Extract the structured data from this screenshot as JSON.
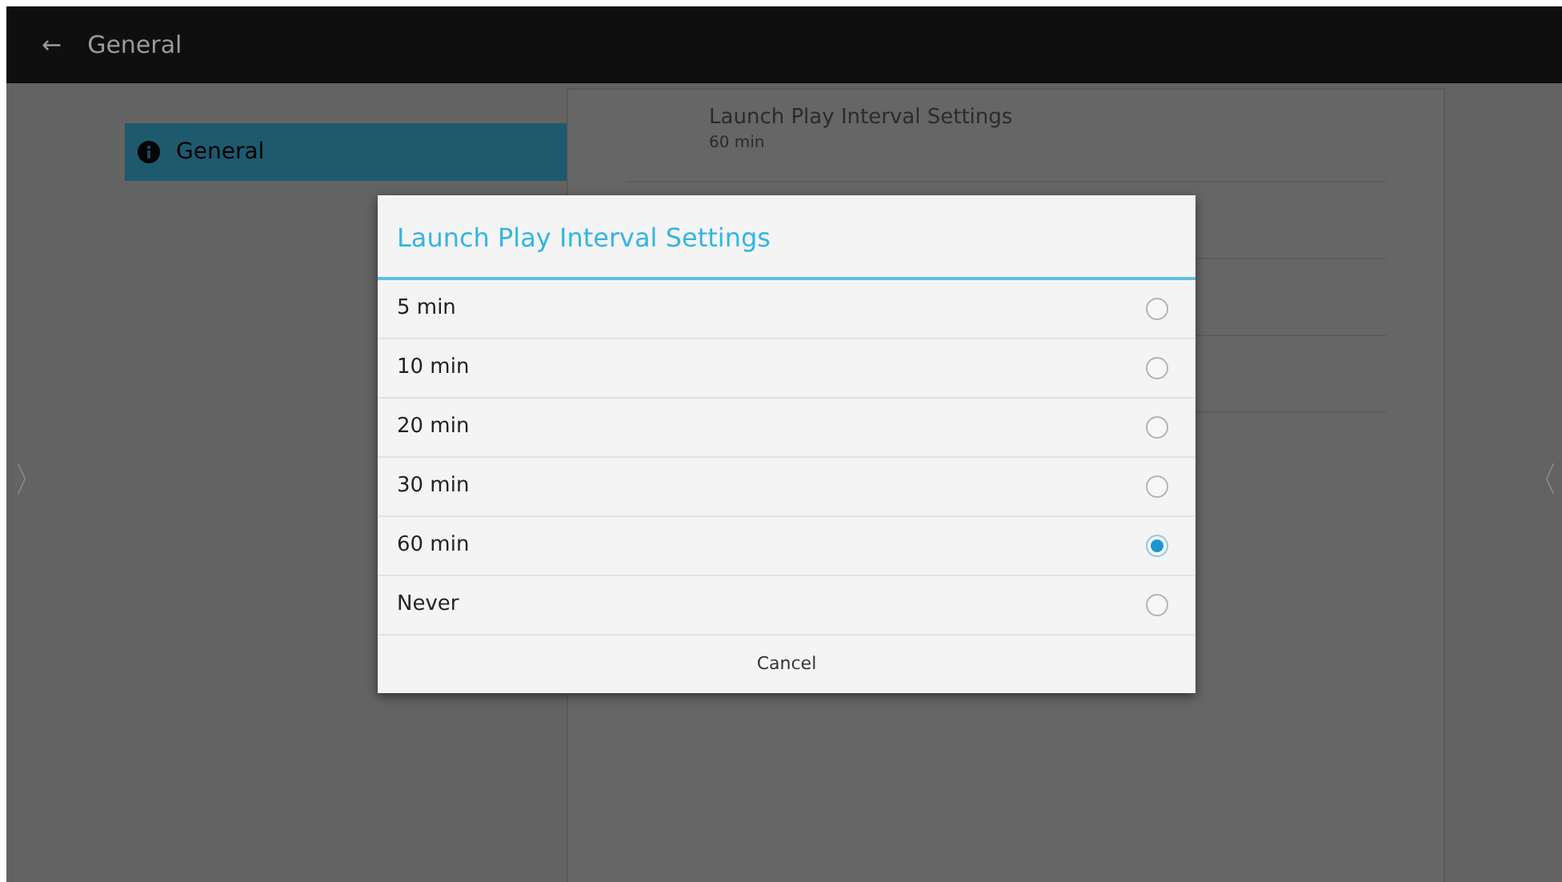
{
  "app_bar": {
    "back_icon": "←",
    "title": "General"
  },
  "sidebar": {
    "items": [
      {
        "label": "General",
        "selected": true
      }
    ]
  },
  "settings_list": [
    {
      "title": "Launch Play Interval Settings",
      "summary": "60 min"
    }
  ],
  "nav_arrows": {
    "left": "〉",
    "right": "〈"
  },
  "dialog": {
    "title": "Launch Play Interval Settings",
    "options": [
      {
        "label": "5 min",
        "selected": false
      },
      {
        "label": "10 min",
        "selected": false
      },
      {
        "label": "20 min",
        "selected": false
      },
      {
        "label": "30 min",
        "selected": false
      },
      {
        "label": "60 min",
        "selected": true
      },
      {
        "label": "Never",
        "selected": false
      }
    ],
    "cancel": "Cancel"
  }
}
